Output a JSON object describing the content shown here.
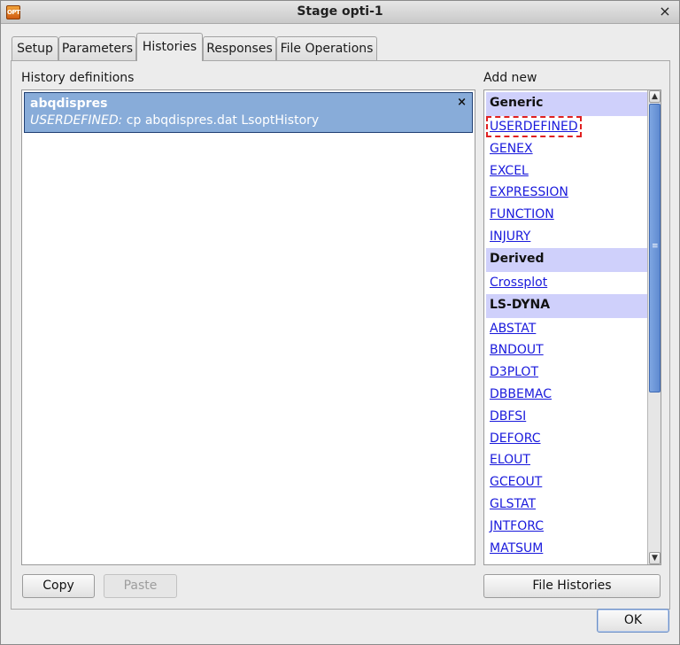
{
  "window": {
    "title": "Stage opti-1",
    "app_icon_text": "OPT",
    "close_glyph": "×"
  },
  "tabs": [
    {
      "label": "Setup",
      "active": false
    },
    {
      "label": "Parameters",
      "active": false
    },
    {
      "label": "Histories",
      "active": true
    },
    {
      "label": "Responses",
      "active": false
    },
    {
      "label": "File Operations",
      "active": false
    }
  ],
  "history": {
    "label": "History definitions",
    "items": [
      {
        "name": "abqdispres",
        "type": "USERDEFINED:",
        "command": " cp abqdispres.dat LsoptHistory",
        "delete_glyph": "×"
      }
    ]
  },
  "add_new": {
    "label": "Add new",
    "groups": [
      {
        "header": "Generic",
        "items": [
          "USERDEFINED",
          "GENEX",
          "EXCEL",
          "EXPRESSION",
          "FUNCTION",
          "INJURY"
        ]
      },
      {
        "header": "Derived",
        "items": [
          "Crossplot"
        ]
      },
      {
        "header": "LS-DYNA",
        "items": [
          "ABSTAT",
          "BNDOUT",
          "D3PLOT",
          "DBBEMAC",
          "DBFSI",
          "DEFORC",
          "ELOUT",
          "GCEOUT",
          "GLSTAT",
          "JNTFORC",
          "MATSUM"
        ]
      }
    ],
    "focused_item": "USERDEFINED",
    "scroll": {
      "up_glyph": "▲",
      "down_glyph": "▼",
      "grip_glyph": "≡"
    }
  },
  "buttons": {
    "copy": "Copy",
    "paste": "Paste",
    "file_histories": "File Histories",
    "ok": "OK"
  },
  "colors": {
    "selection": "#88acd9",
    "group_header": "#cfd0fb",
    "link": "#1a1adc",
    "focus_outline": "#e02020"
  }
}
